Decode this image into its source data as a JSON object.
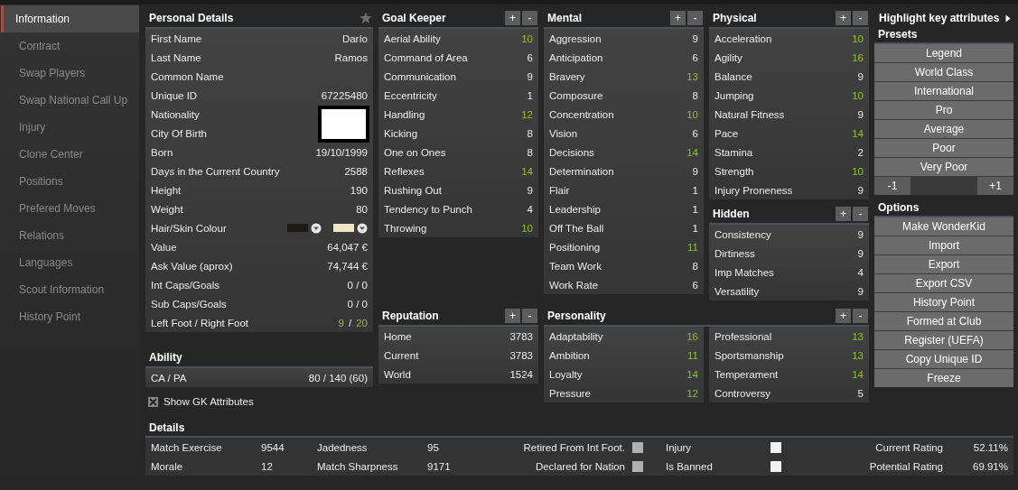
{
  "sidebar": {
    "items": [
      {
        "label": "Information",
        "selected": true
      },
      {
        "label": "Contract",
        "selected": false
      },
      {
        "label": "Swap Players",
        "selected": false
      },
      {
        "label": "Swap National Call Up",
        "selected": false
      },
      {
        "label": "Injury",
        "selected": false
      },
      {
        "label": "Clone Center",
        "selected": false
      },
      {
        "label": "Positions",
        "selected": false
      },
      {
        "label": "Prefered Moves",
        "selected": false
      },
      {
        "label": "Relations",
        "selected": false
      },
      {
        "label": "Languages",
        "selected": false
      },
      {
        "label": "Scout Information",
        "selected": false
      },
      {
        "label": "History Point",
        "selected": false
      }
    ]
  },
  "personal_details": {
    "title": "Personal Details",
    "rows": [
      {
        "kind": "text",
        "label": "First Name",
        "value": "Darío"
      },
      {
        "kind": "text",
        "label": "Last Name",
        "value": "Ramos"
      },
      {
        "kind": "text",
        "label": "Common Name"
      },
      {
        "kind": "text",
        "label": "Unique ID",
        "value": "67225480"
      },
      {
        "kind": "flag",
        "label": "Nationality"
      },
      {
        "kind": "text",
        "label": "City Of Birth"
      },
      {
        "kind": "text",
        "label": "Born",
        "value": "19/10/1999"
      },
      {
        "kind": "text",
        "label": "Days in the Current Country",
        "value": "2588"
      },
      {
        "kind": "text",
        "label": "Height",
        "value": "190"
      },
      {
        "kind": "text",
        "label": "Weight",
        "value": "80"
      },
      {
        "kind": "swatches",
        "label": "Hair/Skin Colour",
        "swatches": [
          {
            "color": "#211a16"
          },
          {
            "color": "#f0e6c6"
          }
        ]
      },
      {
        "kind": "text",
        "label": "Value",
        "value": "64,047 €"
      },
      {
        "kind": "text",
        "label": "Ask Value (aprox)",
        "value": "74,744 €"
      },
      {
        "kind": "text",
        "label": "Int Caps/Goals",
        "value": "0 / 0"
      },
      {
        "kind": "text",
        "label": "Sub Caps/Goals",
        "value": "0 / 0"
      },
      {
        "kind": "parts",
        "label": "Left Foot / Right Foot",
        "parts": [
          {
            "text": "9",
            "highlight": true
          },
          {
            "text": "/",
            "highlight": false
          },
          {
            "text": "20",
            "highlight": true
          }
        ]
      }
    ]
  },
  "ability": {
    "title": "Ability",
    "rows": [
      {
        "kind": "text",
        "label": "CA / PA",
        "value": "80 / 140 (60)"
      }
    ]
  },
  "show_gk": {
    "label": "Show GK Attributes",
    "checked": true
  },
  "goal_keeper": {
    "title": "Goal Keeper",
    "plus": "+",
    "minus": "-",
    "rows": [
      {
        "label": "Aerial Ability",
        "value": "10",
        "highlight": true
      },
      {
        "label": "Command of Area",
        "value": "6",
        "highlight": false
      },
      {
        "label": "Communication",
        "value": "9",
        "highlight": false
      },
      {
        "label": "Eccentricity",
        "value": "1",
        "highlight": false
      },
      {
        "label": "Handling",
        "value": "12",
        "highlight": true
      },
      {
        "label": "Kicking",
        "value": "8",
        "highlight": false
      },
      {
        "label": "One on Ones",
        "value": "8",
        "highlight": false
      },
      {
        "label": "Reflexes",
        "value": "14",
        "highlight": true
      },
      {
        "label": "Rushing Out",
        "value": "9",
        "highlight": false
      },
      {
        "label": "Tendency to Punch",
        "value": "4",
        "highlight": false
      },
      {
        "label": "Throwing",
        "value": "10",
        "highlight": true
      }
    ]
  },
  "mental": {
    "title": "Mental",
    "plus": "+",
    "minus": "-",
    "rows": [
      {
        "label": "Aggression",
        "value": "9",
        "highlight": false
      },
      {
        "label": "Anticipation",
        "value": "6",
        "highlight": false
      },
      {
        "label": "Bravery",
        "value": "13",
        "highlight": true
      },
      {
        "label": "Composure",
        "value": "8",
        "highlight": false
      },
      {
        "label": "Concentration",
        "value": "10",
        "highlight": true
      },
      {
        "label": "Vision",
        "value": "6",
        "highlight": false
      },
      {
        "label": "Decisions",
        "value": "14",
        "highlight": true
      },
      {
        "label": "Determination",
        "value": "9",
        "highlight": false
      },
      {
        "label": "Flair",
        "value": "1",
        "highlight": false
      },
      {
        "label": "Leadership",
        "value": "1",
        "highlight": false
      },
      {
        "label": "Off The Ball",
        "value": "1",
        "highlight": false
      },
      {
        "label": "Positioning",
        "value": "11",
        "highlight": true
      },
      {
        "label": "Team Work",
        "value": "8",
        "highlight": false
      },
      {
        "label": "Work Rate",
        "value": "6",
        "highlight": false
      }
    ]
  },
  "physical": {
    "title": "Physical",
    "plus": "+",
    "minus": "-",
    "rows": [
      {
        "label": "Acceleration",
        "value": "10",
        "highlight": true
      },
      {
        "label": "Agility",
        "value": "16",
        "highlight": true
      },
      {
        "label": "Balance",
        "value": "9",
        "highlight": false
      },
      {
        "label": "Jumping",
        "value": "10",
        "highlight": true
      },
      {
        "label": "Natural Fitness",
        "value": "9",
        "highlight": false
      },
      {
        "label": "Pace",
        "value": "14",
        "highlight": true
      },
      {
        "label": "Stamina",
        "value": "2",
        "highlight": false
      },
      {
        "label": "Strength",
        "value": "10",
        "highlight": true
      },
      {
        "label": "Injury Proneness",
        "value": "9",
        "highlight": false
      }
    ]
  },
  "hidden": {
    "title": "Hidden",
    "plus": "+",
    "minus": "-",
    "rows": [
      {
        "label": "Consistency",
        "value": "9",
        "highlight": false
      },
      {
        "label": "Dirtiness",
        "value": "9",
        "highlight": false
      },
      {
        "label": "Imp Matches",
        "value": "4",
        "highlight": false
      },
      {
        "label": "Versatility",
        "value": "9",
        "highlight": false
      }
    ]
  },
  "reputation": {
    "title": "Reputation",
    "plus": "+",
    "minus": "-",
    "rows": [
      {
        "label": "Home",
        "value": "3783",
        "highlight": false
      },
      {
        "label": "Current",
        "value": "3783",
        "highlight": false
      },
      {
        "label": "World",
        "value": "1524",
        "highlight": false
      }
    ]
  },
  "personality": {
    "title": "Personality",
    "plus": "+",
    "minus": "-",
    "columns": [
      [
        {
          "label": "Adaptability",
          "value": "16",
          "highlight": true
        },
        {
          "label": "Ambition",
          "value": "11",
          "highlight": true
        },
        {
          "label": "Loyalty",
          "value": "14",
          "highlight": true
        },
        {
          "label": "Pressure",
          "value": "12",
          "highlight": true
        }
      ],
      [
        {
          "label": "Professional",
          "value": "13",
          "highlight": true
        },
        {
          "label": "Sportsmanship",
          "value": "13",
          "highlight": true
        },
        {
          "label": "Temperament",
          "value": "14",
          "highlight": true
        },
        {
          "label": "Controversy",
          "value": "5",
          "highlight": false
        }
      ]
    ]
  },
  "highlight_link": "Highlight key attributes",
  "presets": {
    "title": "Presets",
    "buttons": [
      "Legend",
      "World Class",
      "International",
      "Pro",
      "Average",
      "Poor",
      "Very Poor"
    ],
    "minus": "-1",
    "plus": "+1"
  },
  "options": {
    "title": "Options",
    "buttons": [
      "Make WonderKid",
      "Import",
      "Export",
      "Export CSV",
      "History Point",
      "Formed at Club",
      "Register (UEFA)",
      "Copy Unique ID",
      "Freeze"
    ]
  },
  "details": {
    "title": "Details",
    "rows": [
      [
        {
          "kind": "stat",
          "label": "Match Exercise",
          "value": "9544"
        },
        {
          "kind": "stat",
          "label": "Jadedness",
          "value": "95"
        },
        {
          "kind": "check",
          "label": "Retired From Int Foot.",
          "checked": false,
          "disabled": true
        },
        {
          "kind": "check",
          "label": "Injury",
          "checked": false,
          "disabled": false
        },
        {
          "kind": "rating",
          "label": "Current Rating",
          "value": "52.11%"
        }
      ],
      [
        {
          "kind": "stat",
          "label": "Morale",
          "value": "12"
        },
        {
          "kind": "stat",
          "label": "Match Sharpness",
          "value": "9171"
        },
        {
          "kind": "check",
          "label": "Declared for Nation",
          "checked": false,
          "disabled": true
        },
        {
          "kind": "check",
          "label": "Is Banned",
          "checked": false,
          "disabled": false
        },
        {
          "kind": "rating",
          "label": "Potential Rating",
          "value": "69.91%"
        }
      ]
    ]
  }
}
